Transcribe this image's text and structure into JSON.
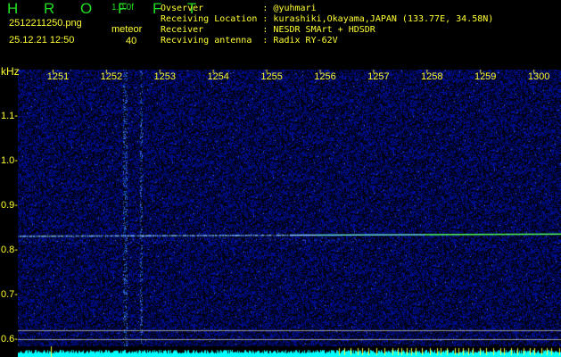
{
  "header": {
    "title": "H R O F F T",
    "version": "1.0.0f",
    "filename": "2512211250.png",
    "datetime": "25.12.21 12:50",
    "meteor_label": "meteor",
    "meteor_count": "40"
  },
  "info": [
    "Ovserver           : @yuhmari",
    "Receiving Location : kurashiki,Okayama,JAPAN (133.77E, 34.58N)",
    "Receiver           : NESDR SMArt + HDSDR",
    "Recviving antenna  : Radix RY-62V"
  ],
  "axis": {
    "y_unit": "kHz",
    "x_ticks": [
      "1251",
      "1252",
      "1253",
      "1254",
      "1255",
      "1256",
      "1257",
      "1258",
      "1259",
      "1300"
    ],
    "y_ticks": [
      "1.1",
      "1.0",
      "0.9",
      "0.8",
      "0.7",
      "0.6"
    ]
  },
  "colors": {
    "text": "#ffff33",
    "title": "#22dd22",
    "signal": "#33ff66",
    "noise": "#1a2aff",
    "level_bar": "#00ffff"
  }
}
